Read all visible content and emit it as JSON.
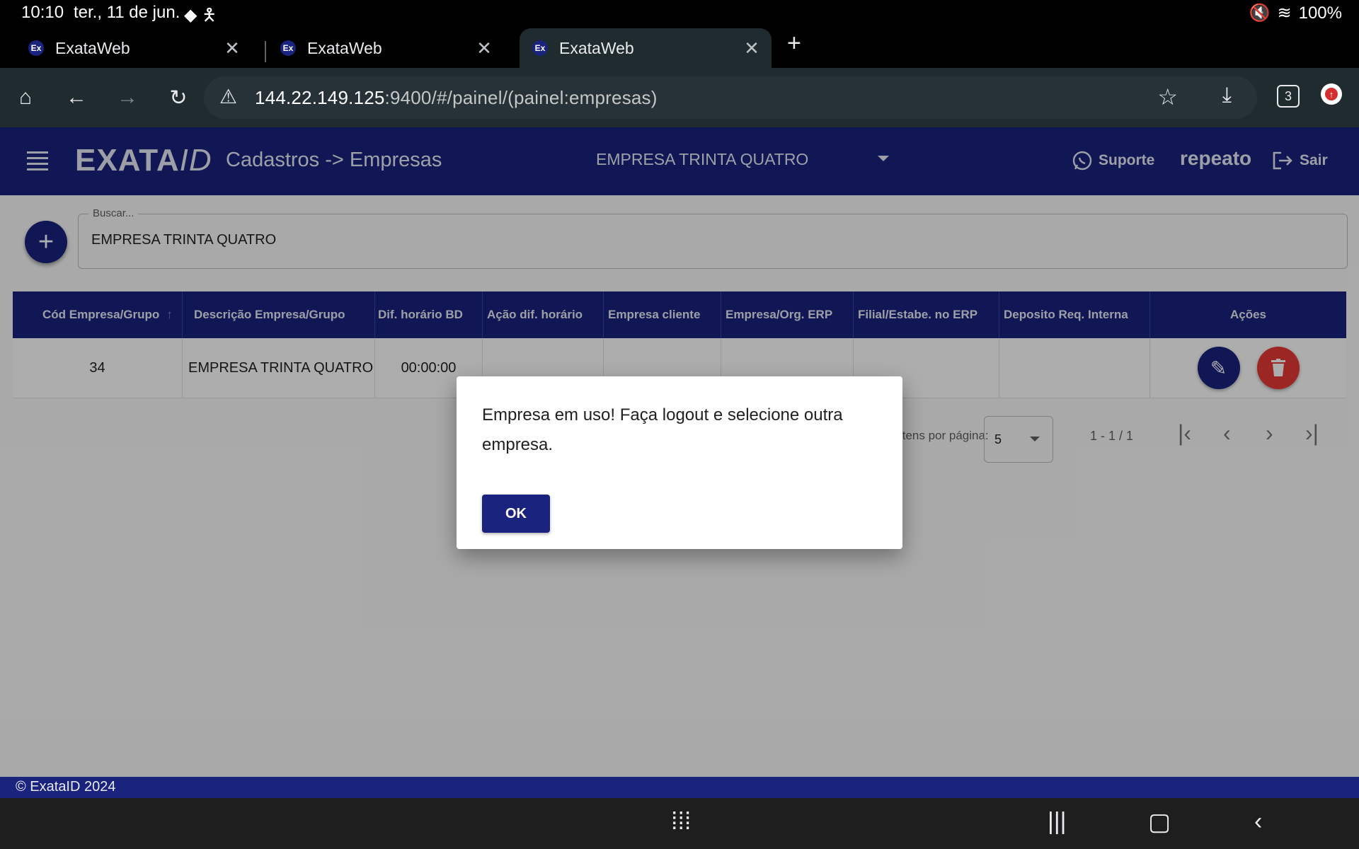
{
  "status_bar": {
    "time": "10:10",
    "date": "ter., 11 de jun.",
    "battery": "100%"
  },
  "tabs": [
    {
      "title": "ExataWeb",
      "favicon": "Ex"
    },
    {
      "title": "ExataWeb",
      "favicon": "Ex"
    },
    {
      "title": "ExataWeb",
      "favicon": "Ex"
    }
  ],
  "toolbar": {
    "url_host": "144.22.149.125",
    "url_path": ":9400/#/painel/(painel:empresas)",
    "tab_count": "3"
  },
  "app": {
    "logo_main": "EXATA",
    "logo_suffix": "ID",
    "page_title": "Cadastros -> Empresas",
    "company_selected": "EMPRESA TRINTA QUATRO",
    "support_label": "Suporte",
    "username": "repeato",
    "logout_label": "Sair",
    "search": {
      "label": "Buscar...",
      "value": "EMPRESA TRINTA QUATRO"
    },
    "table": {
      "columns": [
        "Cód Empresa/Grupo",
        "Descrição Empresa/Grupo",
        "Dif. horário BD",
        "Ação dif. horário",
        "Empresa cliente",
        "Empresa/Org. ERP",
        "Filial/Estabe. no ERP",
        "Deposito Req. Interna",
        "Ações"
      ],
      "rows": [
        {
          "code": "34",
          "description": "EMPRESA TRINTA QUATRO",
          "time_diff": "00:00:00"
        }
      ]
    },
    "paginator": {
      "per_page_label": "Itens por página:",
      "per_page_value": "5",
      "range": "1 - 1 / 1"
    },
    "footer": "© ExataID 2024"
  },
  "dialog": {
    "message": "Empresa em uso! Faça logout e selecione outra empresa.",
    "ok_label": "OK"
  },
  "colors": {
    "primary": "#1a237e",
    "danger": "#e53935"
  }
}
